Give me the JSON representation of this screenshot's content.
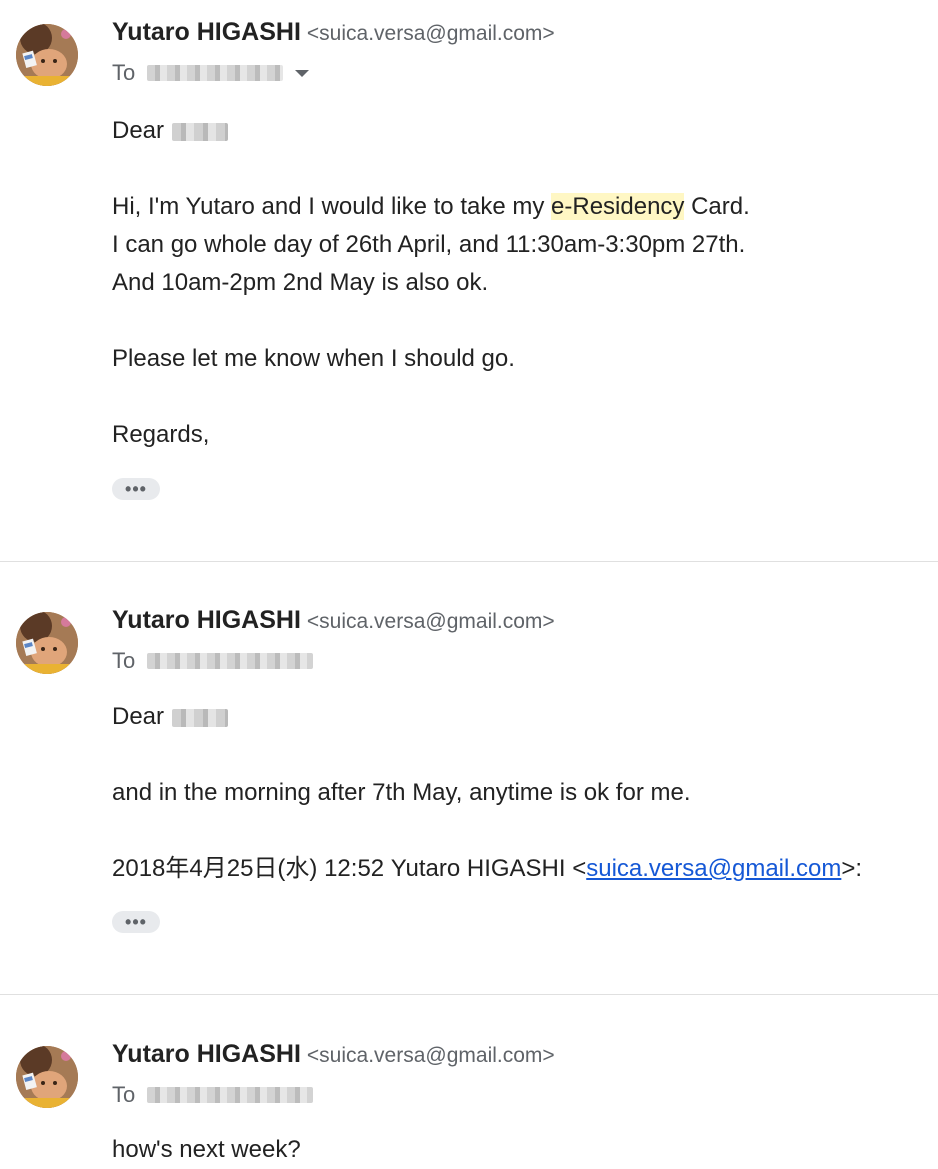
{
  "messages": [
    {
      "sender_name": "Yutaro HIGASHI",
      "sender_email": "<suica.versa@gmail.com>",
      "to_label": "To",
      "greeting": "Dear",
      "lines": {
        "l1_pre": "Hi, I'm Yutaro and I would like to take my ",
        "l1_hl": "e-Residency",
        "l1_post": " Card.",
        "l2": "I can go whole day of 26th April, and 11:30am-3:30pm 27th.",
        "l3": "And 10am-2pm 2nd May is also ok.",
        "l4": "Please let me know when I should go.",
        "l5": "Regards,"
      },
      "ellipsis": "•••"
    },
    {
      "sender_name": "Yutaro HIGASHI",
      "sender_email": "<suica.versa@gmail.com>",
      "to_label": "To",
      "greeting": "Dear",
      "lines": {
        "l1": "and in the morning after 7th May, anytime is ok for me.",
        "quote_pre": "2018年4月25日(水) 12:52 Yutaro HIGASHI <",
        "quote_link": "suica.versa@gmail.com",
        "quote_post": ">:"
      },
      "ellipsis": "•••"
    },
    {
      "sender_name": "Yutaro HIGASHI",
      "sender_email": "<suica.versa@gmail.com>",
      "to_label": "To",
      "lines": {
        "l1": "how's next week?"
      }
    }
  ],
  "icons": {
    "avatar": "avatar-photo",
    "recipient_caret": "chevron-down-icon",
    "ellipsis": "show-trimmed-content-icon"
  },
  "colors": {
    "highlight": "#fff7c4",
    "link": "#1558d6",
    "secondary_text": "#5f6368"
  }
}
